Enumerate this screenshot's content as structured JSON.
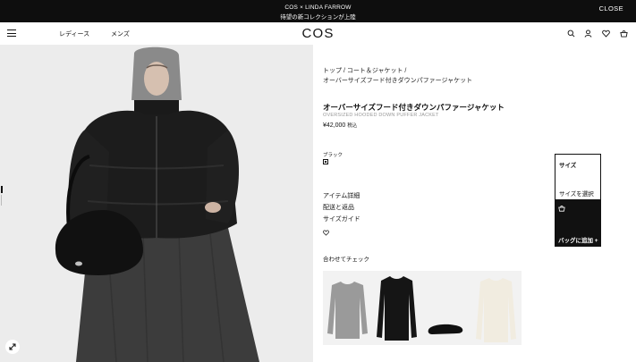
{
  "announcement": {
    "line1": "COS × LINDA FARROW",
    "line2": "待望の新コレクションが上陸",
    "close": "CLOSE"
  },
  "header": {
    "logo": "COS",
    "nav": [
      "レディース",
      "メンズ"
    ],
    "icons": [
      "search-icon",
      "account-icon",
      "wishlist-icon",
      "bag-icon"
    ]
  },
  "breadcrumb": {
    "line1": "トップ / コート＆ジャケット /",
    "line2": "オーバーサイズフード付きダウンパファージャケット"
  },
  "product": {
    "title": "オーバーサイズフード付きダウンパファージャケット",
    "subtitle": "OVERSIZED HOODED DOWN PUFFER JACKET",
    "price": "¥42,000",
    "tax": "税込",
    "color_label": "ブラック",
    "color": "#111111"
  },
  "links": [
    "アイテム詳細",
    "配送と返品",
    "サイズガイド"
  ],
  "size_panel": {
    "label": "サイズ",
    "select": "サイズを選択",
    "add_to_bag": "バッグに追加 +"
  },
  "recommendations": {
    "title": "合わせてチェック",
    "items": [
      "grey-ribbed-top",
      "black-long-sleeve-top",
      "black-ballet-flat",
      "cream-long-sleeve-top"
    ]
  }
}
